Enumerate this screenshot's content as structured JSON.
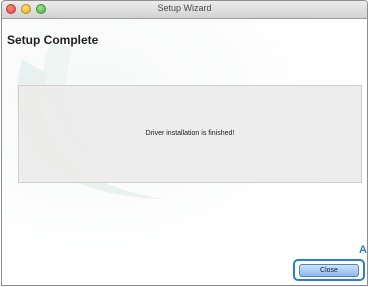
{
  "window": {
    "title": "Setup Wizard"
  },
  "page": {
    "heading": "Setup Complete",
    "message": "Driver installation is finished!"
  },
  "buttons": {
    "close_label": "Close"
  },
  "callout": {
    "mark": "A"
  },
  "colors": {
    "accent": "#2a7fd0",
    "button_top": "#cfe3fb",
    "button_bottom": "#8ab8ef"
  }
}
